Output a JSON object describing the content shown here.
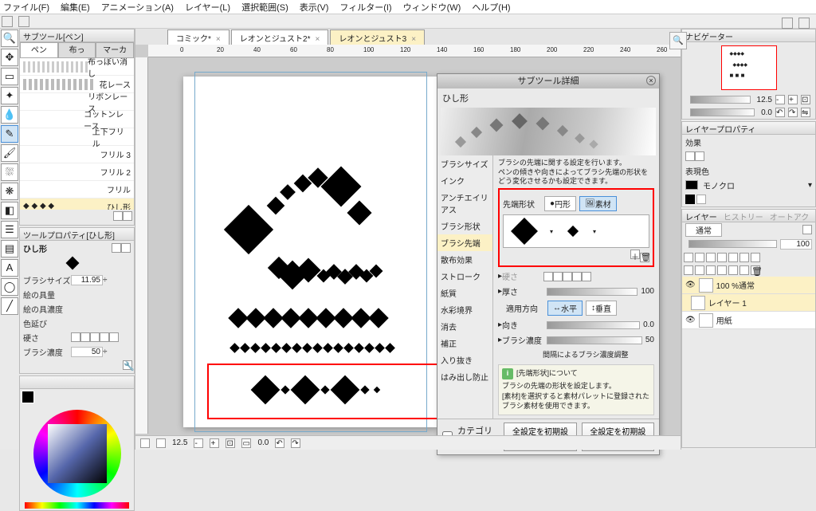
{
  "menu": {
    "file": "ファイル(F)",
    "edit": "編集(E)",
    "animation": "アニメーション(A)",
    "layer": "レイヤー(L)",
    "select": "選択範囲(S)",
    "view": "表示(V)",
    "filter": "フィルター(I)",
    "window": "ウィンドウ(W)",
    "help": "ヘルプ(H)"
  },
  "doc_tabs": [
    {
      "label": "コミック*",
      "close": "×"
    },
    {
      "label": "レオンとジュスト2*",
      "close": "×"
    },
    {
      "label": "レオンとジュスト3",
      "close": "×"
    }
  ],
  "ruler_marks": [
    "0",
    "20",
    "40",
    "60",
    "80",
    "100",
    "120",
    "140",
    "160",
    "180",
    "200",
    "220",
    "240",
    "260"
  ],
  "subtool_panel": {
    "title": "サブツール[ペン]",
    "tabs": [
      "ペン",
      "布っ",
      "マーカ"
    ],
    "brushes": [
      {
        "name": "布っぽい消し"
      },
      {
        "name": "花レース"
      },
      {
        "name": "リボンレース"
      },
      {
        "name": "コットンレース"
      },
      {
        "name": "上下フリル"
      },
      {
        "name": "フリル 3"
      },
      {
        "name": "フリル 2"
      },
      {
        "name": "フリル"
      },
      {
        "name": "ひし形",
        "selected": true
      }
    ]
  },
  "tool_property": {
    "title": "ツールプロパティ[ひし形]",
    "header": "ひし形",
    "rows": [
      {
        "label": "ブラシサイズ",
        "value": "11.95",
        "enabled": true
      },
      {
        "label": "絵の具量",
        "value": "",
        "enabled": false
      },
      {
        "label": "絵の具濃度",
        "value": "",
        "enabled": false
      },
      {
        "label": "色延び",
        "value": "",
        "enabled": false
      },
      {
        "label": "硬さ",
        "value": "",
        "enabled": false
      },
      {
        "label": "ブラシ濃度",
        "value": "50",
        "enabled": true
      }
    ]
  },
  "status": {
    "zoom": "12.5",
    "angle": "0.0"
  },
  "float": {
    "title": "サブツール詳細",
    "header": "ひし形",
    "side": [
      "ブラシサイズ",
      "インク",
      "アンチエイリアス",
      "ブラシ形状",
      "ブラシ先端",
      "散布効果",
      "ストローク",
      "紙質",
      "水彩境界",
      "消去",
      "補正",
      "入り抜き",
      "はみ出し防止"
    ],
    "side_selected": "ブラシ先端",
    "desc1": "ブラシの先端に関する設定を行います。",
    "desc2": "ペンの傾きや向きによってブラシ先端の形状をどう変化させるかも設定できます。",
    "tip_shape_label": "先端形状",
    "circle": "円形",
    "material": "素材",
    "hardness": "硬さ",
    "thickness": "厚さ",
    "thickness_val": "100",
    "apply_dir": "適用方向",
    "horiz": "水平",
    "vert": "垂直",
    "direction": "向き",
    "direction_val": "0.0",
    "brush_density": "ブラシ濃度",
    "brush_density_val": "50",
    "interval_note": "間隔によるブラシ濃度調整",
    "info_title": "[先端形状]について",
    "info_body": "ブラシの先端の形状を設定します。\n[素材]を選択すると素材パレットに登録されたブラシ素材を使用できます。",
    "category": "カテゴリ表示",
    "btn_reset": "全設定を初期設定に戻す",
    "btn_save": "全設定を初期設定に登録"
  },
  "right": {
    "navigator": "ナビゲーター",
    "nav_zoom": "12.5",
    "nav_angle": "0.0",
    "layer_prop": "レイヤープロパティ",
    "effect": "効果",
    "expr_color": "表現色",
    "monochrome": "モノクロ",
    "layer_panel": "レイヤー",
    "history": "ヒストリー",
    "auto": "オートアク",
    "blend": "通常",
    "opacity": "100",
    "layers": [
      {
        "name": "100 %通常"
      },
      {
        "name": "レイヤー 1"
      },
      {
        "name": "用紙"
      }
    ]
  }
}
